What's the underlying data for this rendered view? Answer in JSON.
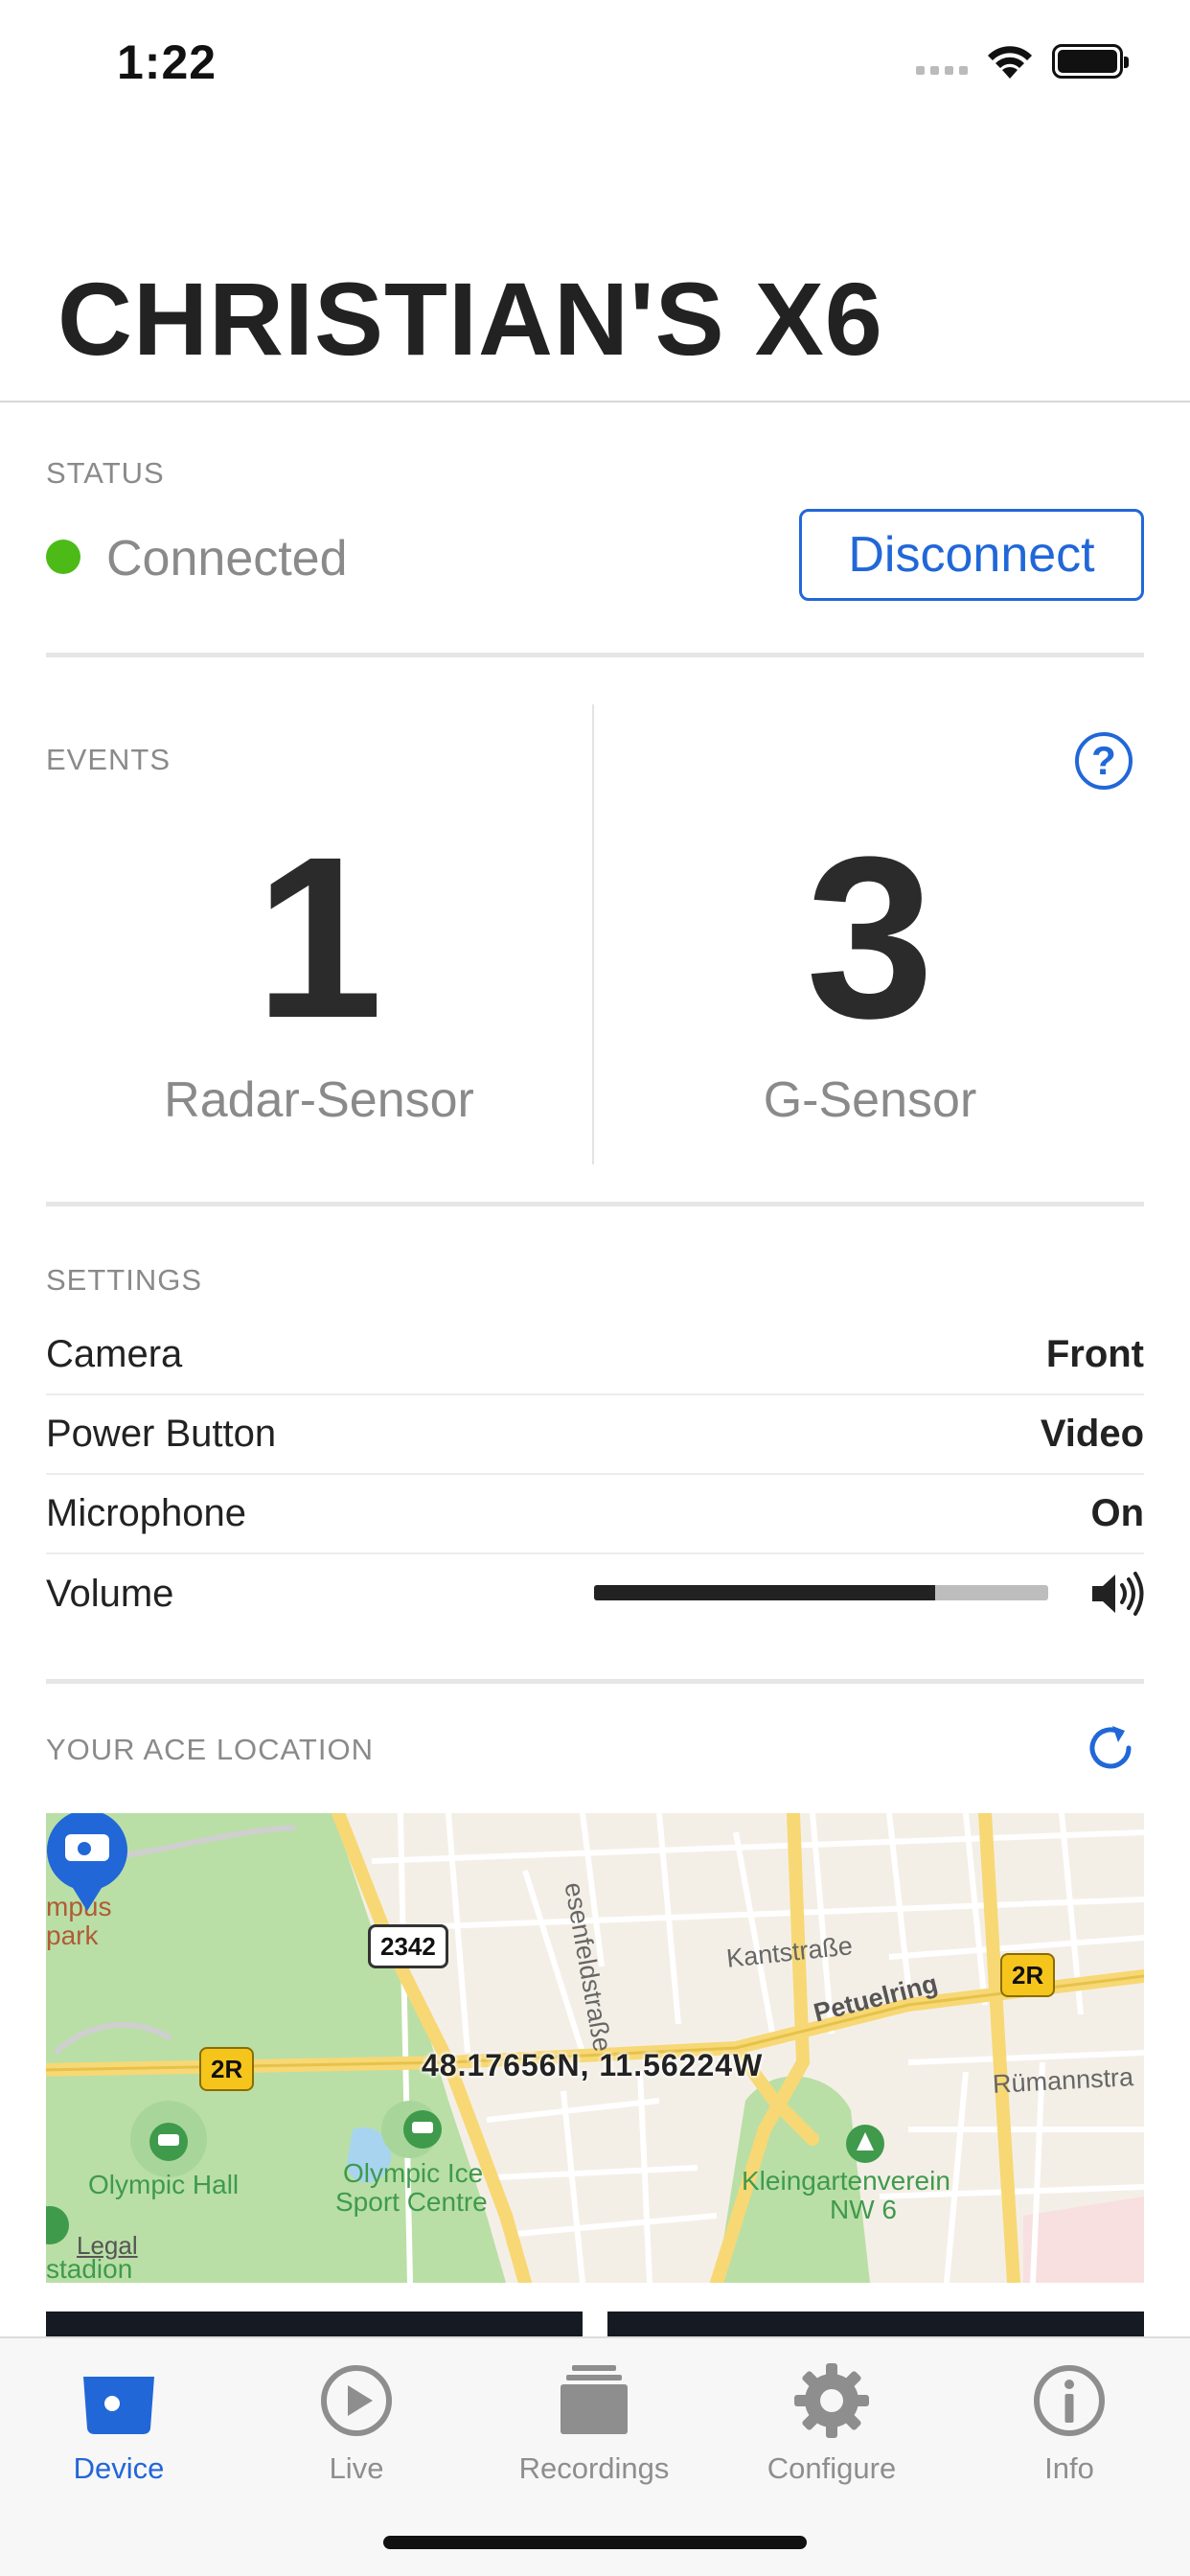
{
  "status_bar": {
    "time": "1:22"
  },
  "header": {
    "title": "CHRISTIAN'S X6"
  },
  "status": {
    "section_label": "STATUS",
    "connection_text": "Connected",
    "connection_color": "#4cbb17",
    "disconnect_label": "Disconnect"
  },
  "events": {
    "section_label": "EVENTS",
    "radar": {
      "count": "1",
      "label": "Radar-Sensor"
    },
    "gsensor": {
      "count": "3",
      "label": "G-Sensor"
    },
    "help_icon": "question-circle-icon"
  },
  "settings": {
    "section_label": "SETTINGS",
    "rows": [
      {
        "key": "Camera",
        "value": "Front"
      },
      {
        "key": "Power Button",
        "value": "Video"
      },
      {
        "key": "Microphone",
        "value": "On"
      }
    ],
    "volume": {
      "key": "Volume",
      "level": 0.75,
      "icon": "speaker-icon"
    }
  },
  "location": {
    "section_label": "YOUR ACE LOCATION",
    "refresh_icon": "refresh-icon",
    "coordinates": "48.17656N, 11.56224W",
    "map_labels": {
      "campus_1": "mpus",
      "campus_2": "park",
      "olympic_hall": "Olympic Hall",
      "ice_1": "Olympic Ice",
      "ice_2": "Sport Centre",
      "kleingarten_1": "Kleingartenverein",
      "kleingarten_2": "NW 6",
      "stadion": "stadion",
      "legal": "Legal",
      "road_2342": "2342",
      "road_2r": "2R",
      "kantstrasse": "Kantstraße",
      "petuelring": "Petuelring",
      "rumannstr": "Rümannstra",
      "esenfeld": "esenfeldstraße"
    }
  },
  "tabs": [
    {
      "label": "Device",
      "icon": "device-icon",
      "active": true
    },
    {
      "label": "Live",
      "icon": "play-circle-icon",
      "active": false
    },
    {
      "label": "Recordings",
      "icon": "recordings-stack-icon",
      "active": false
    },
    {
      "label": "Configure",
      "icon": "gear-icon",
      "active": false
    },
    {
      "label": "Info",
      "icon": "info-circle-icon",
      "active": false
    }
  ],
  "colors": {
    "accent": "#2167d8",
    "text": "#222222",
    "muted": "#8a8a8a"
  }
}
